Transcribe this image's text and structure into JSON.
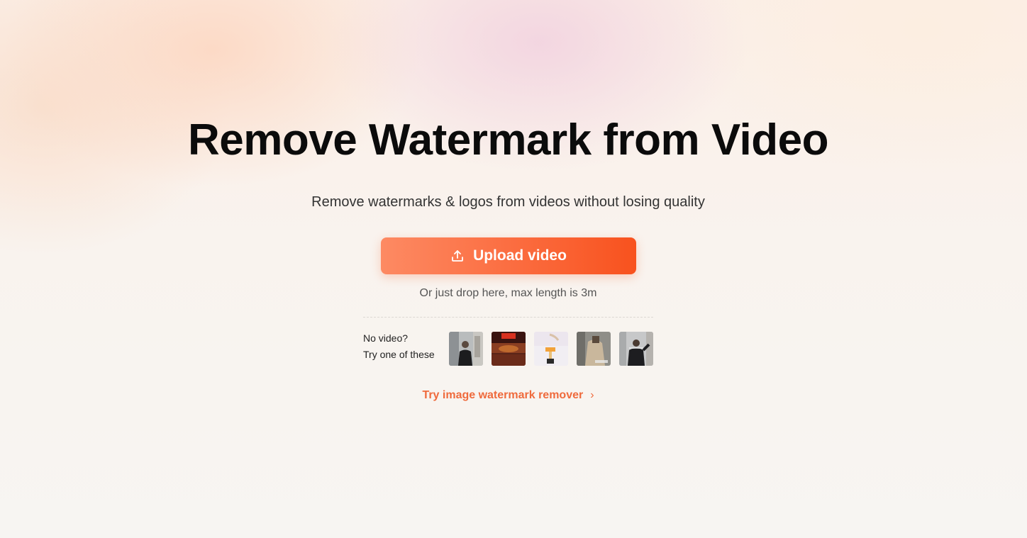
{
  "hero": {
    "title": "Remove Watermark from Video",
    "subtitle": "Remove watermarks & logos from videos without losing quality"
  },
  "upload": {
    "button_label": "Upload video",
    "icon": "upload-icon",
    "drop_hint": "Or just drop here, max length is 3m"
  },
  "samples": {
    "line1": "No video?",
    "line2": "Try one of these",
    "thumbnails": [
      {
        "name": "sample-video-1"
      },
      {
        "name": "sample-video-2"
      },
      {
        "name": "sample-video-3"
      },
      {
        "name": "sample-video-4"
      },
      {
        "name": "sample-video-5"
      }
    ]
  },
  "alt_link": {
    "label": "Try image watermark remover",
    "icon": "chevron-right-icon"
  },
  "colors": {
    "accent": "#fb6b3e",
    "link": "#ef6a3c",
    "title": "#0b0b0b"
  }
}
